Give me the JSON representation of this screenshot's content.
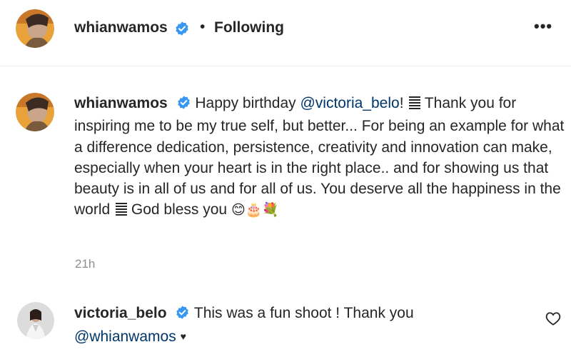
{
  "post_header": {
    "username": "whianwamos",
    "separator": "•",
    "follow_status": "Following",
    "more_label": "•••"
  },
  "caption": {
    "username": "whianwamos",
    "text_before_mention": "Happy birthday ",
    "mention": "@victoria_belo",
    "text_after_mention": "! ",
    "text_main": " Thank you for inspiring me to be my true self, but better... For being an example for what a difference dedication, persistence, creativity and innovation can make, especially when your heart is in the right place.. and for showing us that beauty is in all of us and for all of us. You deserve all the happiness in the world ",
    "text_end": " God bless you ",
    "emojis": "😊🎂💐",
    "time": "21h"
  },
  "comment": {
    "username": "victoria_belo",
    "text": "This was a fun shoot ! Thank you",
    "mention": "@whianwamos",
    "heart": "♥"
  },
  "colors": {
    "text": "#262626",
    "secondary": "#8e8e8e",
    "link": "#00376b",
    "verified": "#3897f0"
  }
}
